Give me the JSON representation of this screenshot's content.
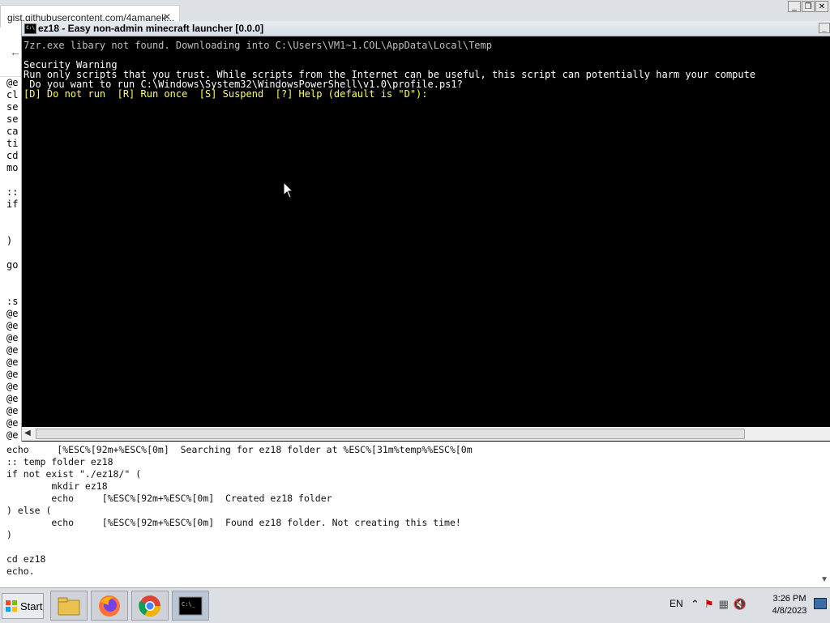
{
  "browser": {
    "tab_title": "gist.githubusercontent.com/4amanek...",
    "tab_close": "✕",
    "back_icon": "←",
    "window_controls": [
      "_",
      "❐",
      "✕"
    ],
    "left_code": [
      "@e",
      "cl",
      "se",
      "se",
      "ca",
      "ti",
      "cd",
      "mo",
      "",
      "::",
      "if",
      "",
      "",
      ")",
      "",
      "go",
      "",
      "",
      ":s",
      "@e",
      "@e",
      "@e",
      "@e",
      "@e",
      "@e",
      "@e",
      "@e",
      "@e",
      "@e",
      "@e",
      "@e",
      "ec"
    ],
    "bottom_code": [
      "echo     [%ESC%[92m+%ESC%[0m]  Searching for ez18 folder at %ESC%[31m%temp%%ESC%[0m",
      ":: temp folder ez18",
      "if not exist \"./ez18/\" (",
      "        mkdir ez18",
      "        echo     [%ESC%[92m+%ESC%[0m]  Created ez18 folder",
      ") else (",
      "        echo     [%ESC%[92m+%ESC%[0m]  Found ez18 folder. Not creating this time!",
      ")",
      "",
      "cd ez18",
      "echo."
    ]
  },
  "console": {
    "title": "ez18 - Easy non-admin minecraft launcher [0.0.0]",
    "icon_label": "C:\\",
    "minimize": "_",
    "lines": [
      {
        "text": "7zr.exe libary not found. Downloading into C:\\Users\\VM1~1.COL\\AppData\\Local\\Temp",
        "style": "normal"
      },
      {
        "text": "",
        "style": "normal"
      },
      {
        "text": "Security Warning",
        "style": "white"
      },
      {
        "text": "Run only scripts that you trust. While scripts from the Internet can be useful, this script can potentially harm your compute",
        "style": "white"
      },
      {
        "text": " Do you want to run C:\\Windows\\System32\\WindowsPowerShell\\v1.0\\profile.ps1?",
        "style": "white"
      },
      {
        "text": "[D] Do not run  [R] Run once  [S] Suspend  [?] Help (default is \"D\"):",
        "style": "yellow"
      }
    ]
  },
  "taskbar": {
    "start_label": "Start",
    "apps": [
      "file-explorer",
      "firefox",
      "chrome",
      "command-prompt"
    ],
    "language": "EN",
    "time": "3:26 PM",
    "date": "4/8/2023"
  },
  "colors": {
    "console_bg": "#000000",
    "console_text": "#c0c0c0",
    "prompt_yellow": "#ffff55",
    "taskbar_bg": "#dcdfe3"
  }
}
